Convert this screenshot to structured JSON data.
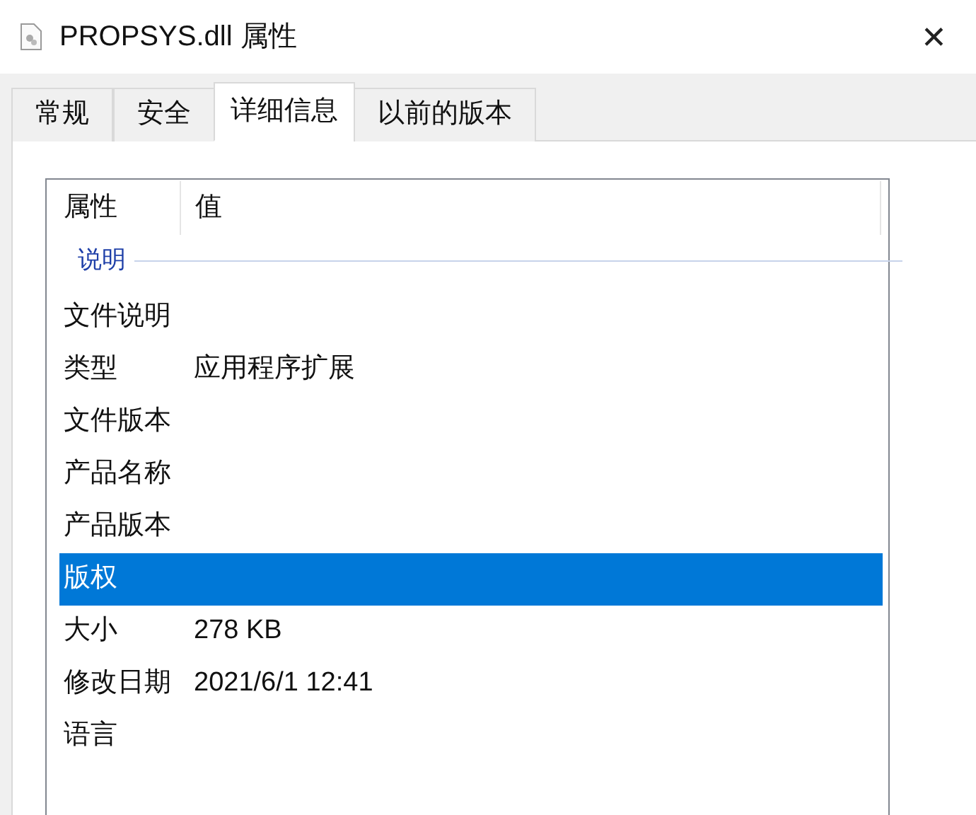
{
  "window": {
    "title": "PROPSYS.dll 属性",
    "close": "✕"
  },
  "tabs": [
    {
      "label": "常规",
      "selected": false
    },
    {
      "label": "安全",
      "selected": false
    },
    {
      "label": "详细信息",
      "selected": true
    },
    {
      "label": "以前的版本",
      "selected": false
    }
  ],
  "table": {
    "columns": [
      "属性",
      "值"
    ],
    "group": "说明",
    "rows": [
      {
        "property": "文件说明",
        "selected": false
      },
      {
        "property": "类型",
        "value": "应用程序扩展",
        "selected": false
      },
      {
        "property": "文件版本",
        "selected": false
      },
      {
        "property": "产品名称",
        "selected": false
      },
      {
        "property": "产品版本",
        "selected": false
      },
      {
        "property": "版权",
        "selected": true
      },
      {
        "property": "大小",
        "value": "278 KB",
        "selected": false
      },
      {
        "property": "修改日期",
        "value": "2021/6/1 12:41",
        "selected": false
      },
      {
        "property": "语言",
        "selected": false
      }
    ]
  }
}
